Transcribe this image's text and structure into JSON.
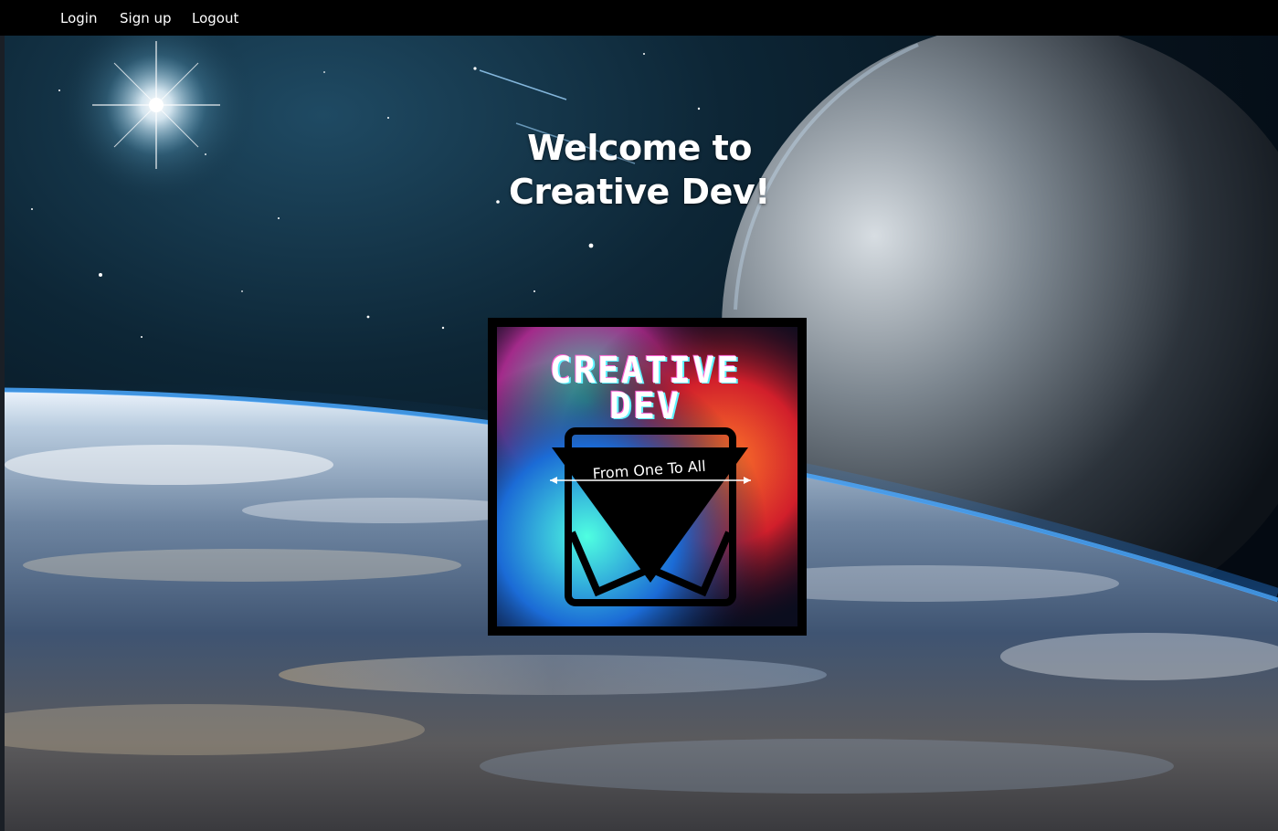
{
  "nav": {
    "links": [
      {
        "label": "Login"
      },
      {
        "label": "Sign up"
      },
      {
        "label": "Logout"
      }
    ]
  },
  "hero": {
    "title_line1": "Welcome to",
    "title_line2": "Creative Dev!"
  },
  "logo": {
    "line1": "CREATIVE",
    "line2": "DEV",
    "tagline": "From One To All"
  },
  "colors": {
    "navbar": "#000000",
    "nav_text": "#ffffff",
    "title_text": "#ffffff",
    "logo_text_pink": "#ff5fd2",
    "logo_text_cyan": "#5ff3ff"
  }
}
